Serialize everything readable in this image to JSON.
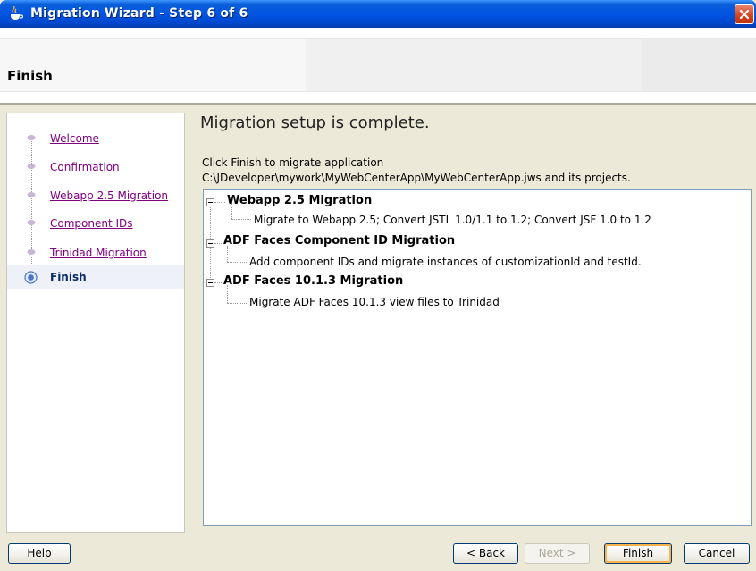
{
  "window": {
    "title": "Migration Wizard - Step 6 of 6"
  },
  "header": {
    "title": "Finish"
  },
  "nav": {
    "items": [
      {
        "label": "Welcome"
      },
      {
        "label": "Confirmation"
      },
      {
        "label": "Webapp 2.5 Migration"
      },
      {
        "label": "Component IDs"
      },
      {
        "label": "Trinidad Migration"
      },
      {
        "label": "Finish"
      }
    ]
  },
  "main": {
    "heading": "Migration setup is complete.",
    "line1": "Click Finish to migrate application",
    "line2": "C:\\JDeveloper\\mywork\\MyWebCenterApp\\MyWebCenterApp.jws and its projects."
  },
  "tree": {
    "nodes": [
      {
        "label": "Webapp 2.5 Migration",
        "child": "Migrate to Webapp 2.5; Convert JSTL 1.0/1.1 to 1.2; Convert JSF 1.0 to 1.2"
      },
      {
        "label": "ADF Faces Component ID Migration",
        "child": "Add component IDs and migrate instances of customizationId and testId."
      },
      {
        "label": "ADF Faces 10.1.3 Migration",
        "child": "Migrate ADF Faces 10.1.3 view files to Trinidad"
      }
    ]
  },
  "buttons": {
    "help_u": "H",
    "help_rest": "elp",
    "back_pre": "< ",
    "back_u": "B",
    "back_rest": "ack",
    "next_u": "N",
    "next_rest": "ext >",
    "finish_u": "F",
    "finish_rest": "inish",
    "cancel": "Cancel"
  },
  "colors": {
    "titlebar": "#0054e3",
    "visited_link": "#800080",
    "active_step": "#0a2a6a",
    "dialog_bg": "#ece9d8"
  },
  "icons": [
    "java-cup-icon",
    "close-icon",
    "step-bullet-icon",
    "current-step-icon",
    "collapse-icon"
  ]
}
